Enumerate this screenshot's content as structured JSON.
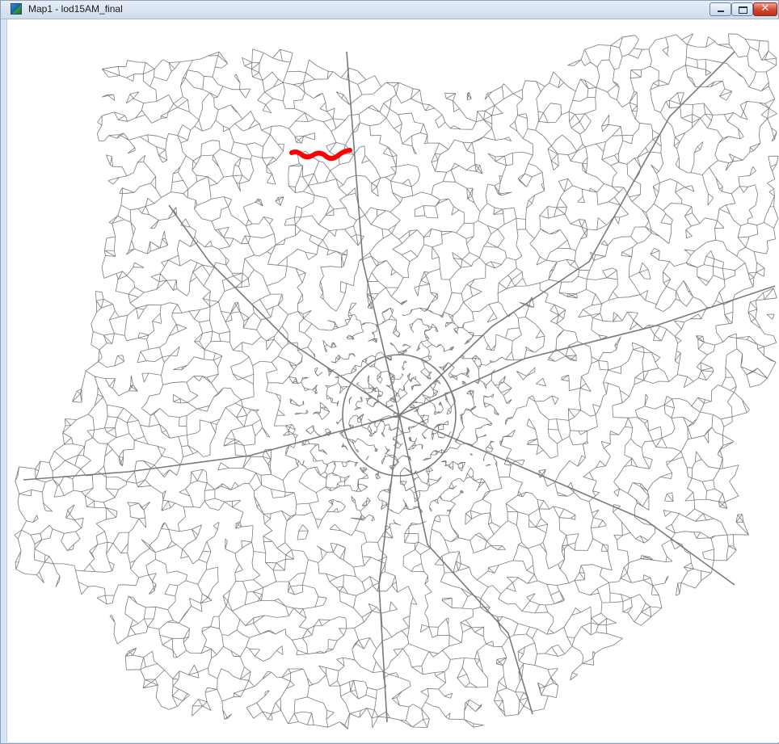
{
  "window": {
    "title": "Map1 - lod15AM_final",
    "app_icon": "map-app-icon",
    "controls": {
      "minimize_icon": "minimize-icon",
      "maximize_icon": "maximize-icon",
      "close_icon": "close-icon",
      "close_glyph": "✕"
    }
  },
  "map": {
    "layer": "lod15AM_final",
    "network_color": "#7a7a7a",
    "highlight_color": "#ff0000",
    "background_color": "#ffffff"
  }
}
